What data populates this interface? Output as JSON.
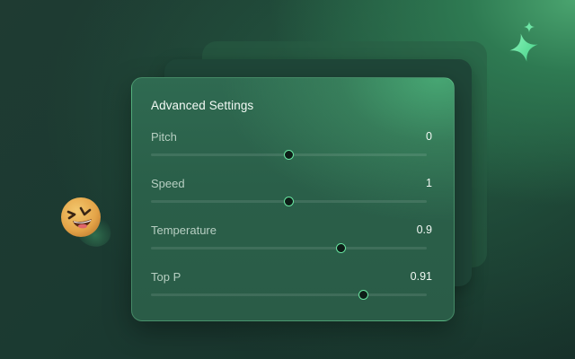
{
  "panel": {
    "title": "Advanced Settings",
    "sliders": [
      {
        "label": "Pitch",
        "value": "0",
        "level": 0.5
      },
      {
        "label": "Speed",
        "value": "1",
        "level": 0.5
      },
      {
        "label": "Temperature",
        "value": "0.9",
        "level": 0.69
      },
      {
        "label": "Top P",
        "value": "0.91",
        "level": 0.77
      }
    ]
  },
  "decor": {
    "sparkle_icon": "sparkle-icon",
    "emoji_icon": "laughing-face-emoji",
    "accent_color": "#68e5a0"
  }
}
